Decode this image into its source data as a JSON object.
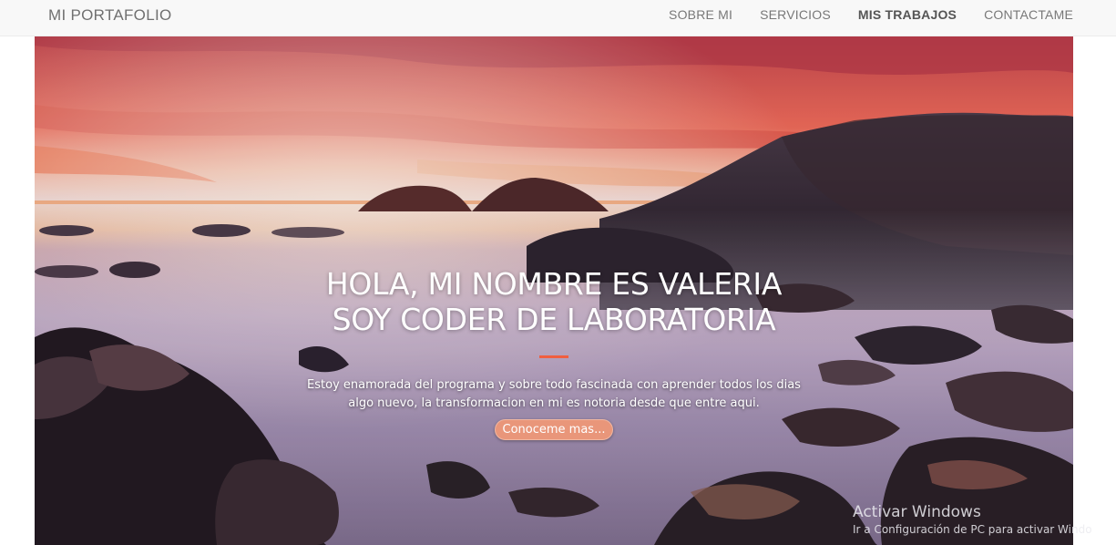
{
  "navbar": {
    "brand": "MI PORTAFOLIO",
    "links": [
      {
        "label": "SOBRE MI",
        "active": false
      },
      {
        "label": "SERVICIOS",
        "active": false
      },
      {
        "label": "MIS TRABAJOS",
        "active": true
      },
      {
        "label": "CONTACTAME",
        "active": false
      }
    ]
  },
  "hero": {
    "title_line1": "HOLA, MI NOMBRE ES VALERIA",
    "title_line2": "SOY CODER DE LABORATORIA",
    "text_line1": "Estoy enamorada del programa y sobre todo fascinada con aprender todos los dias",
    "text_line2": "algo nuevo, la transformacion en mi es notoria desde que entre aqui.",
    "button_label": "Conoceme mas...",
    "accent_color": "#f05f40",
    "background_description": "sunset-coast-rocks-image"
  },
  "watermark": {
    "title": "Activar Windows",
    "subtitle": "Ir a Configuración de PC para activar Windo"
  }
}
